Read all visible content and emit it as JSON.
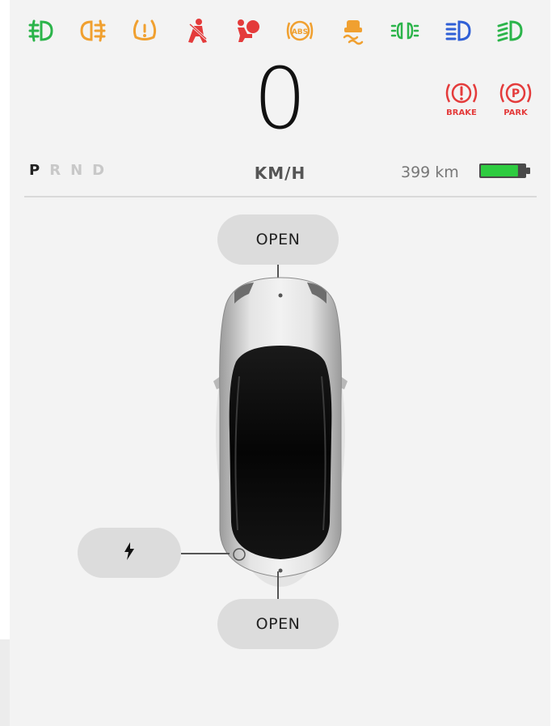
{
  "telltales": [
    {
      "icon": "front-fog-light-icon",
      "color": "#2bb44a"
    },
    {
      "icon": "rear-fog-light-icon",
      "color": "#f0a030"
    },
    {
      "icon": "tire-pressure-warning-icon",
      "color": "#f0a030"
    },
    {
      "icon": "seatbelt-warning-icon",
      "color": "#e43b3b"
    },
    {
      "icon": "airbag-warning-icon",
      "color": "#e43b3b"
    },
    {
      "icon": "abs-warning-icon",
      "color": "#f0a030"
    },
    {
      "icon": "traction-control-icon",
      "color": "#f0a030"
    },
    {
      "icon": "parking-lights-icon",
      "color": "#2bb44a"
    },
    {
      "icon": "high-beam-icon",
      "color": "#2f5fd6"
    },
    {
      "icon": "low-beam-icon",
      "color": "#2bb44a"
    }
  ],
  "speed": {
    "value": "0",
    "unit": "KM/H"
  },
  "gears": {
    "p": "P",
    "r": "R",
    "n": "N",
    "d": "D",
    "active": "P"
  },
  "range": {
    "text": "399 km",
    "battery_level": 0.85,
    "battery_color": "#2ecc40"
  },
  "warnings": {
    "brake": {
      "label": "BRAKE",
      "icon": "brake-warning-icon",
      "color": "#e43b3b"
    },
    "park": {
      "label": "PARK",
      "icon": "parking-brake-icon",
      "color": "#e43b3b"
    }
  },
  "controls": {
    "front_trunk": "OPEN",
    "rear_trunk": "OPEN",
    "charge_port_icon": "lightning-bolt-icon"
  }
}
